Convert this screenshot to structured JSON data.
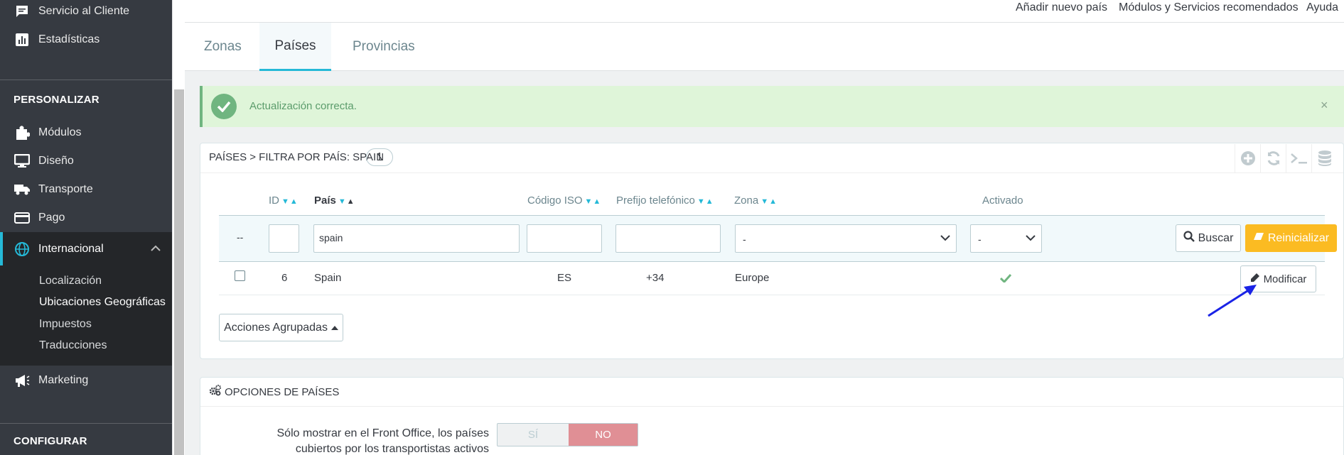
{
  "sidebar": {
    "items_top": [
      {
        "label": "Servicio al Cliente",
        "icon": "chat-icon"
      },
      {
        "label": "Estadísticas",
        "icon": "bar-chart-icon"
      }
    ],
    "section_personalizar": "PERSONALIZAR",
    "items_personalizar": [
      {
        "label": "Módulos",
        "icon": "puzzle-icon"
      },
      {
        "label": "Diseño",
        "icon": "monitor-icon"
      },
      {
        "label": "Transporte",
        "icon": "truck-icon"
      },
      {
        "label": "Pago",
        "icon": "credit-card-icon"
      },
      {
        "label": "Internacional",
        "icon": "globe-icon"
      }
    ],
    "sub_items": [
      "Localización",
      "Ubicaciones Geográficas",
      "Impuestos",
      "Traducciones"
    ],
    "marketing": {
      "label": "Marketing",
      "icon": "megaphone-icon"
    },
    "section_configurar": "CONFIGURAR"
  },
  "header": {
    "links": [
      "Añadir nuevo país",
      "Módulos y Servicios recomendados",
      "Ayuda"
    ]
  },
  "tabs": [
    "Zonas",
    "Países",
    "Provincias"
  ],
  "alert": {
    "message": "Actualización correcta.",
    "close": "×"
  },
  "panel": {
    "title": "PAÍSES > FILTRA POR PAÍS: SPAIN",
    "count": "1",
    "columns": [
      "ID",
      "País",
      "Código ISO",
      "Prefijo telefónico",
      "Zona",
      "Activado"
    ],
    "filter": {
      "dashes": "--",
      "country_value": "spain",
      "zone_value": "-",
      "active_value": "-",
      "search_label": "Buscar",
      "reset_label": "Reinicializar"
    },
    "row": {
      "id": "6",
      "country": "Spain",
      "iso": "ES",
      "prefix": "+34",
      "zone": "Europe",
      "edit_label": "Modificar"
    },
    "bulk_label": "Acciones Agrupadas"
  },
  "options": {
    "title": "OPCIONES DE PAÍSES",
    "label": "Sólo mostrar en el Front Office, los países cubiertos por los transportistas activos",
    "yes": "SÍ",
    "no": "NO"
  },
  "colors": {
    "accent": "#25b9d7",
    "warning": "#fbbb22",
    "success": "#70b580",
    "annotation": "#1a23e6"
  }
}
